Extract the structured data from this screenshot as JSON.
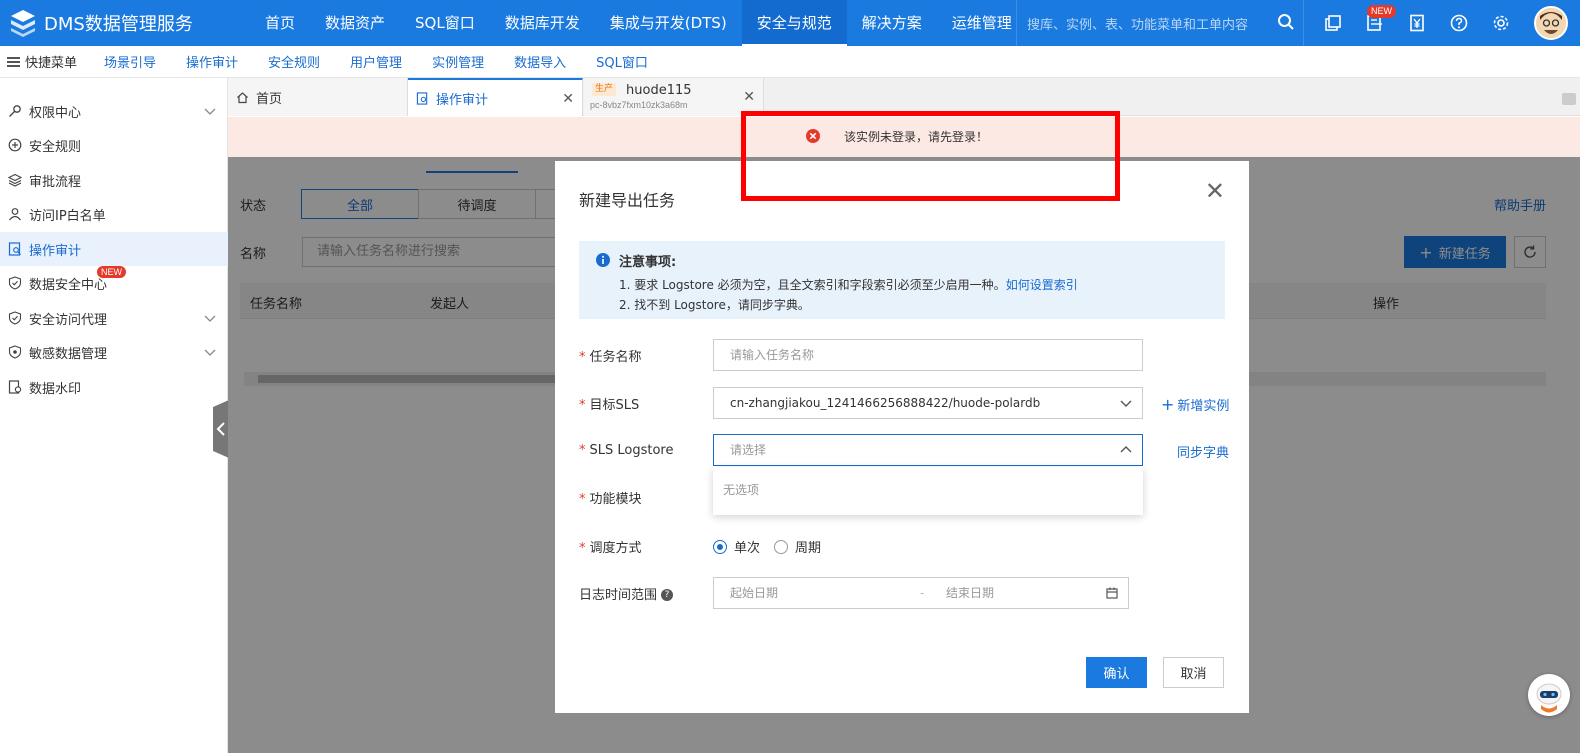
{
  "app": {
    "title": "DMS数据管理服务"
  },
  "topnav": {
    "items": [
      "首页",
      "数据资产",
      "SQL窗口",
      "数据库开发",
      "集成与开发(DTS)",
      "安全与规范",
      "解决方案",
      "运维管理"
    ],
    "search_placeholder": "搜库、实例、表、功能菜单和工单内容",
    "new_badge": "NEW"
  },
  "quickbar": {
    "menu_label": "快捷菜单",
    "links": [
      "场景引导",
      "操作审计",
      "安全规则",
      "用户管理",
      "实例管理",
      "数据导入",
      "SQL窗口"
    ]
  },
  "sidebar": {
    "items": [
      {
        "label": "权限中心",
        "icon": "key-icon",
        "expandable": true
      },
      {
        "label": "安全规则",
        "icon": "shield-plus-icon",
        "expandable": false
      },
      {
        "label": "审批流程",
        "icon": "layers-icon",
        "expandable": false
      },
      {
        "label": "访问IP白名单",
        "icon": "user-icon",
        "expandable": false
      },
      {
        "label": "操作审计",
        "icon": "audit-icon",
        "expandable": false
      },
      {
        "label": "数据安全中心",
        "icon": "shield-check-icon",
        "expandable": false,
        "badge": "NEW"
      },
      {
        "label": "安全访问代理",
        "icon": "shield-check-icon",
        "expandable": true
      },
      {
        "label": "敏感数据管理",
        "icon": "shield-eye-icon",
        "expandable": true
      },
      {
        "label": "数据水印",
        "icon": "watermark-icon",
        "expandable": false
      }
    ]
  },
  "tabs": {
    "home": "首页",
    "audit": "操作审计",
    "instance_tag": "生产",
    "instance_name": "huode115",
    "instance_id": "pc-8vbz7fxm10zk3a68m"
  },
  "alert": {
    "message": "该实例未登录，请先登录！"
  },
  "page": {
    "status_label": "状态",
    "status_options": [
      "全部",
      "待调度",
      ""
    ],
    "name_label": "名称",
    "name_placeholder": "请输入任务名称进行搜索",
    "help": "帮助手册",
    "new_task": "新建任务",
    "columns": [
      "任务名称",
      "发起人",
      "操作"
    ]
  },
  "dialog": {
    "title": "新建导出任务",
    "notice_title": "注意事项:",
    "notice_line1": "1. 要求 Logstore 必须为空，且全文索引和字段索引必须至少启用一种。",
    "notice_link": "如何设置索引",
    "notice_line2": "2. 找不到 Logstore，请同步字典。",
    "fields": {
      "task_name": {
        "label": "任务名称",
        "placeholder": "请输入任务名称"
      },
      "target_sls": {
        "label": "目标SLS",
        "value": "cn-zhangjiakou_1241466256888422/huode-polardb",
        "link": "新增实例"
      },
      "logstore": {
        "label": "SLS Logstore",
        "placeholder": "请选择",
        "link": "同步字典",
        "empty": "无选项"
      },
      "module": {
        "label": "功能模块"
      },
      "schedule": {
        "label": "调度方式",
        "options": [
          "单次",
          "周期"
        ],
        "selected": "单次"
      },
      "log_range": {
        "label": "日志时间范围",
        "start_placeholder": "起始日期",
        "separator": "-",
        "end_placeholder": "结束日期"
      }
    },
    "confirm": "确认",
    "cancel": "取消"
  },
  "colors": {
    "primary": "#1a7ae0",
    "alert_bg": "#fde9e3",
    "error": "#e5392b",
    "annotation": "#ff0000"
  }
}
